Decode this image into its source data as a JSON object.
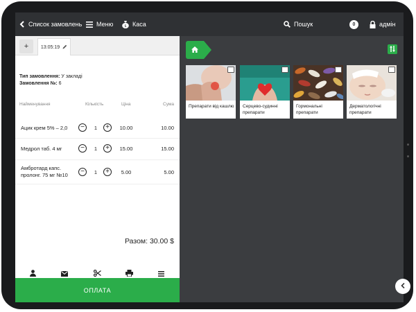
{
  "topbar": {
    "back_label": "Список замовлень",
    "menu_label": "Меню",
    "cash_label": "Каса",
    "search_label": "Пошук",
    "notifications_count": "0",
    "user_label": "адмін"
  },
  "order": {
    "add_tab_label": "+",
    "tab_time": "13:05:19",
    "type_label": "Тип замовлення:",
    "type_value": "У закладі",
    "number_label": "Замовлення №:",
    "number_value": "6",
    "columns": {
      "name": "Найменування",
      "qty": "Кількість",
      "price": "Ціна",
      "sum": "Сума"
    },
    "items": [
      {
        "name": "Ацик крем 5% – 2,0",
        "qty": "1",
        "price": "10.00",
        "sum": "10.00"
      },
      {
        "name": "Медрол таб. 4 мг",
        "qty": "1",
        "price": "15.00",
        "sum": "15.00"
      },
      {
        "name": "Амбротард капс. пролонг. 75 мг №10",
        "qty": "1",
        "price": "5.00",
        "sum": "5.00"
      }
    ],
    "total": "Разом: 30.00 $",
    "pay_label": "ОПЛАТА"
  },
  "catalog": {
    "categories": [
      {
        "label": "Препарати від кашлю",
        "icon": "folder-icon"
      },
      {
        "label": "Серцево-судинні препарати",
        "icon": "folder-icon"
      },
      {
        "label": "Гормональні препарати",
        "icon": "folder-icon"
      },
      {
        "label": "Дерматологічні препарати",
        "icon": "folder-icon"
      }
    ]
  },
  "colors": {
    "accent": "#2bad4a",
    "topbar": "#2f3134",
    "catalog_bg": "#3b3d40"
  }
}
